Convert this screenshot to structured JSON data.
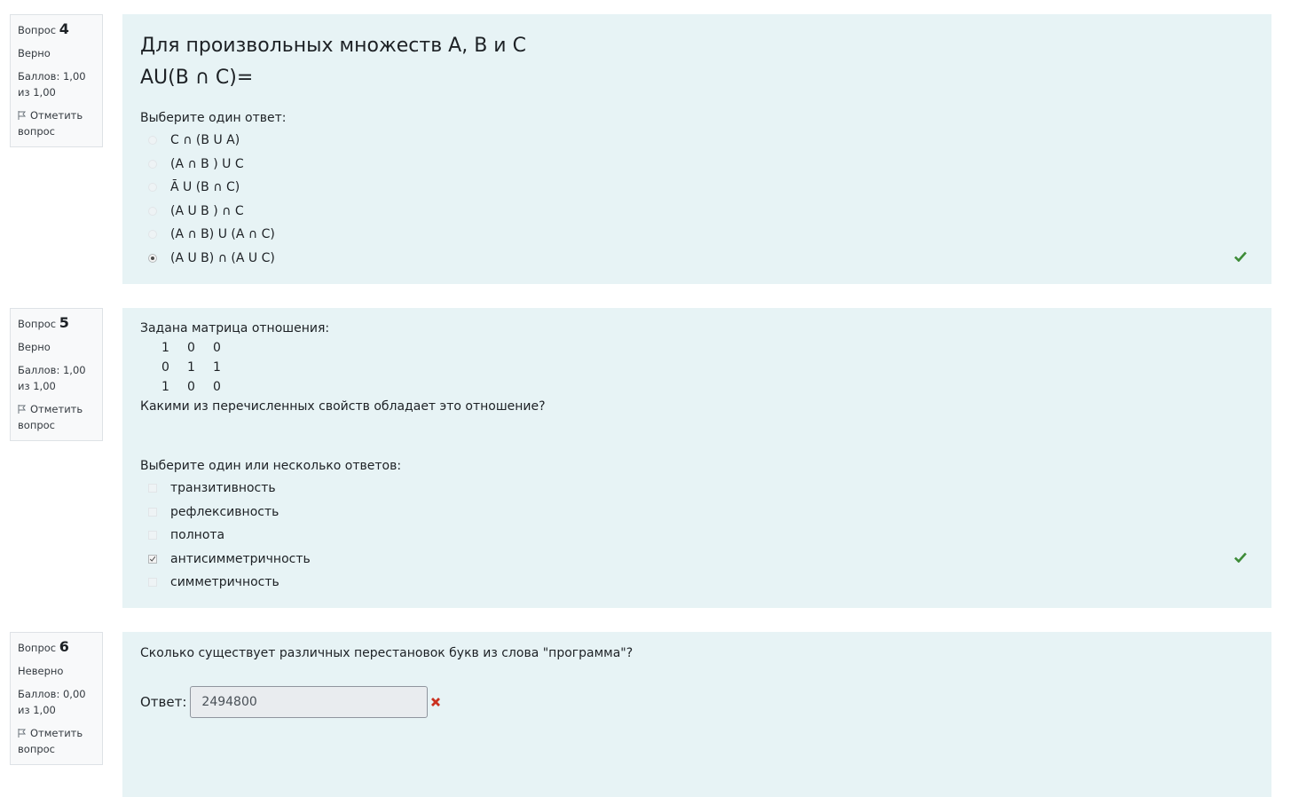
{
  "q4": {
    "label": "Вопрос",
    "number": "4",
    "state": "Верно",
    "grade": "Баллов: 1,00 из 1,00",
    "flag": "Отметить вопрос",
    "text_line1": "Для произвольных множеств A, B и C",
    "text_line2": "AU(B ∩ C)=",
    "prompt": "Выберите один ответ:",
    "options": [
      {
        "label": "C ∩ (B U A)",
        "selected": false
      },
      {
        "label": "(A ∩ B ) U C",
        "selected": false
      },
      {
        "label": "Ā U (B ∩ C)",
        "selected": false
      },
      {
        "label": "(A U B ) ∩ C",
        "selected": false
      },
      {
        "label": "(A ∩ B) U (A ∩ C)",
        "selected": false
      },
      {
        "label": "(A U B) ∩ (A U C)",
        "selected": true
      }
    ]
  },
  "q5": {
    "label": "Вопрос",
    "number": "5",
    "state": "Верно",
    "grade": "Баллов: 1,00 из 1,00",
    "flag": "Отметить вопрос",
    "intro": "Задана матрица отношения:",
    "matrix": [
      [
        "1",
        "0",
        "0"
      ],
      [
        "0",
        "1",
        "1"
      ],
      [
        "1",
        "0",
        "0"
      ]
    ],
    "question": "Какими из перечисленных свойств обладает это отношение?",
    "prompt": "Выберите один или несколько ответов:",
    "options": [
      {
        "label": "транзитивность",
        "checked": false
      },
      {
        "label": "рефлексивность",
        "checked": false
      },
      {
        "label": "полнота",
        "checked": false
      },
      {
        "label": "антисимметричность",
        "checked": true
      },
      {
        "label": "симметричность",
        "checked": false
      }
    ]
  },
  "q6": {
    "label": "Вопрос",
    "number": "6",
    "state": "Неверно",
    "grade": "Баллов: 0,00 из 1,00",
    "flag": "Отметить вопрос",
    "text": "Сколько существует различных перестановок букв из слова \"программа\"?",
    "answer_label": "Ответ:",
    "answer_value": "2494800"
  },
  "colors": {
    "correct": "#3d8b37",
    "incorrect": "#ca3120",
    "content_bg": "#e7f3f5"
  }
}
